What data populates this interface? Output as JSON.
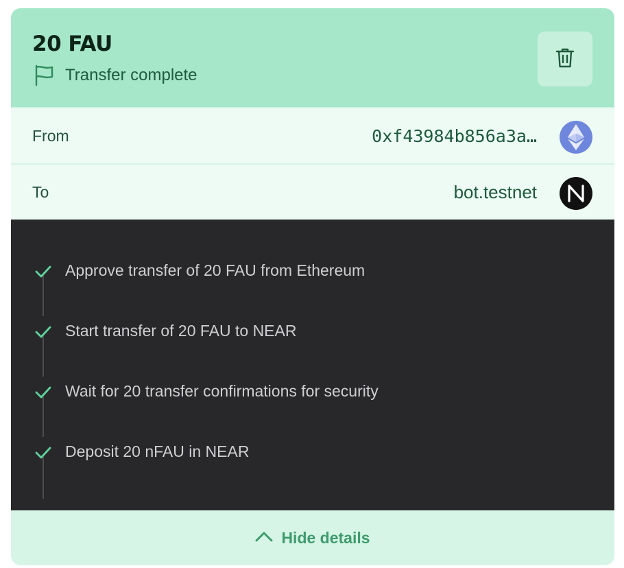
{
  "transfer": {
    "amount": "20 FAU",
    "status": "Transfer complete",
    "delete_icon": "trash-icon",
    "status_icon": "flag-icon"
  },
  "from": {
    "label": "From",
    "value": "0xf43984b856a3a…",
    "chain_icon": "ethereum-icon"
  },
  "to": {
    "label": "To",
    "value": "bot.testnet",
    "chain_icon": "near-icon"
  },
  "steps": [
    {
      "text": "Approve transfer of 20 FAU from Ethereum",
      "done": true
    },
    {
      "text": "Start transfer of 20 FAU to NEAR",
      "done": true
    },
    {
      "text": "Wait for 20 transfer confirmations for security",
      "done": true
    },
    {
      "text": "Deposit 20 nFAU in NEAR",
      "done": true
    }
  ],
  "footer": {
    "toggle_label": "Hide details",
    "toggle_icon": "chevron-up-icon"
  },
  "colors": {
    "header_bg": "#a6e7c9",
    "accent_green": "#3f9b6d",
    "steps_bg": "#28282a",
    "check_green": "#5fd39b"
  }
}
